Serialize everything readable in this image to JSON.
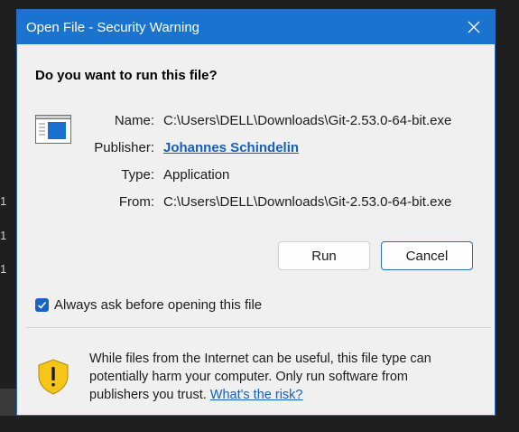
{
  "dialog": {
    "title": "Open File - Security Warning",
    "question": "Do you want to run this file?",
    "fields": {
      "name_label": "Name:",
      "name_value": "C:\\Users\\DELL\\Downloads\\Git-2.53.0-64-bit.exe",
      "publisher_label": "Publisher:",
      "publisher_value": "Johannes Schindelin",
      "type_label": "Type:",
      "type_value": "Application",
      "from_label": "From:",
      "from_value": "C:\\Users\\DELL\\Downloads\\Git-2.53.0-64-bit.exe"
    },
    "buttons": {
      "run": "Run",
      "cancel": "Cancel"
    },
    "checkbox": {
      "label": "Always ask before opening this file",
      "checked": true
    },
    "warning": {
      "text": "While files from the Internet can be useful, this file type can potentially harm your computer. Only run software from publishers you trust. ",
      "link": "What's the risk?"
    }
  },
  "background": {
    "marks": [
      "1",
      "1",
      "1"
    ]
  },
  "colors": {
    "titlebar": "#1a73cf",
    "accent": "#1a63c6",
    "link": "#1560bd",
    "shield": "#f5c518"
  },
  "icons": [
    "close-icon",
    "application-window-icon",
    "checkmark-icon",
    "warning-shield-icon"
  ]
}
